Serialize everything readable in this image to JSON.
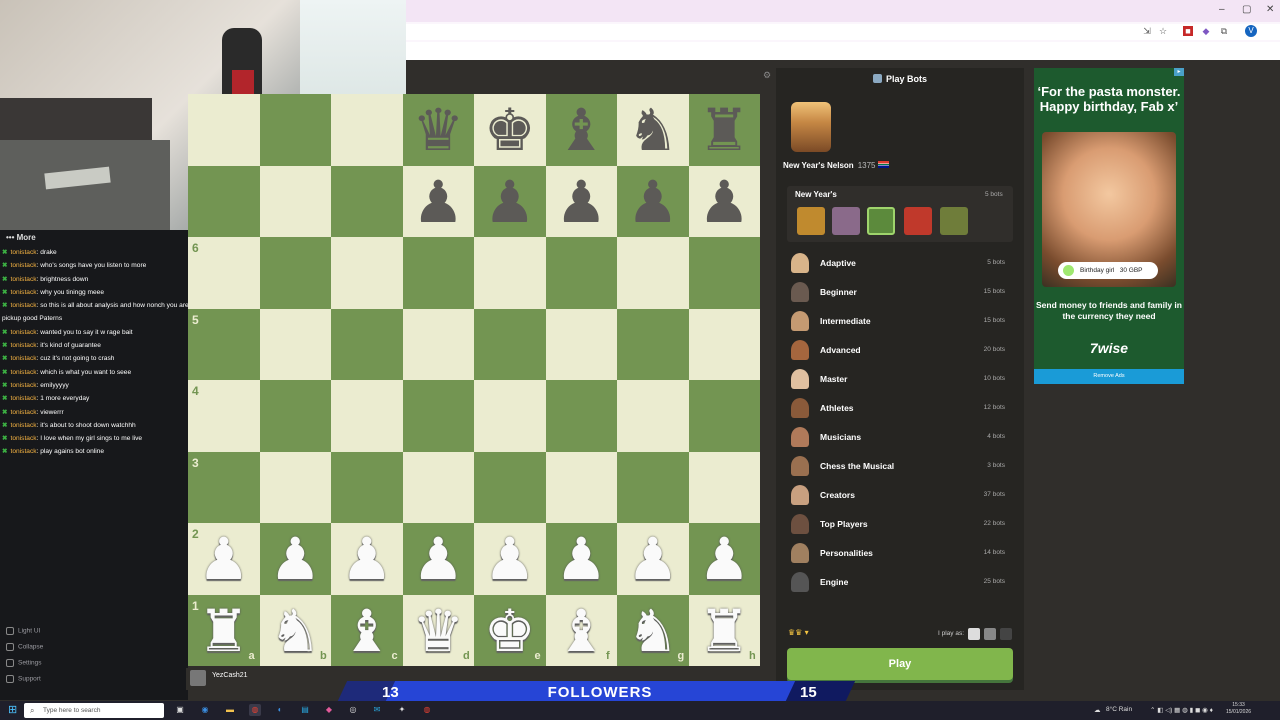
{
  "browser": {
    "window_controls": [
      "–",
      "▢",
      "✕"
    ],
    "profile_initial": "V"
  },
  "stream_panel": {
    "more_label": "More",
    "chat": [
      {
        "user": "tonistack",
        "text": ": drake"
      },
      {
        "user": "tonistack",
        "text": ": who's songs have you listen to more"
      },
      {
        "user": "tonistack",
        "text": ": brightness down"
      },
      {
        "user": "tonistack",
        "text": ": why you tiningg meee"
      },
      {
        "user": "tonistack",
        "text": ": so this is all about analysis and how nonch you are to the brain can"
      },
      {
        "user": "",
        "text": "pickup good Paterns"
      },
      {
        "user": "tonistack",
        "text": ": wanted you to say it w rage bait"
      },
      {
        "user": "tonistack",
        "text": ": it's kind of guarantee"
      },
      {
        "user": "tonistack",
        "text": ": cuz it's not going to crash"
      },
      {
        "user": "tonistack",
        "text": ": which is what you want to seee"
      },
      {
        "user": "tonistack",
        "text": ": emilyyyyy"
      },
      {
        "user": "tonistack",
        "text": ": 1 more everyday"
      },
      {
        "user": "tonistack",
        "text": ": viewerrr"
      },
      {
        "user": "tonistack",
        "text": ": it's about to shoot down watchhh"
      },
      {
        "user": "tonistack",
        "text": ": I love when my girl sings to me live"
      },
      {
        "user": "tonistack",
        "text": ": play agains bot online"
      }
    ],
    "side_items": [
      "Light UI",
      "Collapse",
      "Settings",
      "Support"
    ]
  },
  "board": {
    "ranks_visible": [
      "6",
      "5",
      "4",
      "3",
      "2",
      "1"
    ],
    "files": [
      "a",
      "b",
      "c",
      "d",
      "e",
      "f",
      "g",
      "h"
    ],
    "black_back": [
      "♛",
      "♚",
      "♝",
      "♞",
      "♜"
    ],
    "black_pawns": [
      "♟",
      "♟",
      "♟",
      "♟",
      "♟"
    ],
    "white_pawns": [
      "♟",
      "♟",
      "♟",
      "♟",
      "♟",
      "♟",
      "♟",
      "♟"
    ],
    "white_back": [
      "♜",
      "♞",
      "♝",
      "♛",
      "♚",
      "♝",
      "♞",
      "♜"
    ],
    "player_name": "YezCash21"
  },
  "bots_panel": {
    "title": "Play Bots",
    "featured_name": "New Year's Nelson",
    "featured_rating": "1375",
    "section_title": "New Year's",
    "section_count": "5 bots",
    "categories": [
      {
        "label": "Adaptive",
        "count": "5 bots"
      },
      {
        "label": "Beginner",
        "count": "15 bots"
      },
      {
        "label": "Intermediate",
        "count": "15 bots"
      },
      {
        "label": "Advanced",
        "count": "20 bots"
      },
      {
        "label": "Master",
        "count": "10 bots"
      },
      {
        "label": "Athletes",
        "count": "12 bots"
      },
      {
        "label": "Musicians",
        "count": "4 bots"
      },
      {
        "label": "Chess the Musical",
        "count": "3 bots"
      },
      {
        "label": "Creators",
        "count": "37 bots"
      },
      {
        "label": "Top Players",
        "count": "22 bots"
      },
      {
        "label": "Personalities",
        "count": "14 bots"
      },
      {
        "label": "Engine",
        "count": "25 bots"
      }
    ],
    "i_play_as": "I play as:",
    "play_button": "Play"
  },
  "ad": {
    "quote": "‘For the pasta monster. Happy birthday, Fab x’",
    "pill_text": "Birthday girl",
    "pill_amount": "30 GBP",
    "body": "Send money to friends and family in the currency they need",
    "logo": "7wise",
    "remove": "Remove Ads"
  },
  "followers_bar": {
    "left": "13",
    "label": "FOLLOWERS",
    "right": "15"
  },
  "taskbar": {
    "search_placeholder": "Type here to search",
    "weather": "8°C  Rain",
    "time": "15:33",
    "date": "15/01/2026"
  },
  "colors": {
    "board_light": "#ebecd0",
    "board_dark": "#739552",
    "play_green": "#81b64c",
    "followers_blue": "#2645d6"
  }
}
